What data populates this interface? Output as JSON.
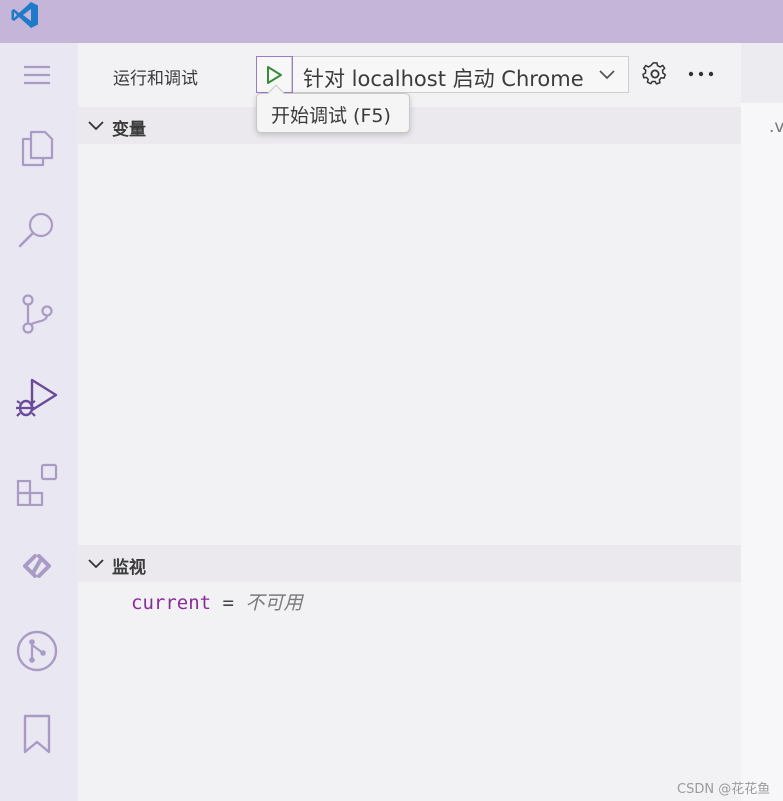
{
  "titlebar": {
    "logo_icon": "vscode-logo-icon",
    "background": "#c5b5d9"
  },
  "activitybar": {
    "items": [
      {
        "name": "menu",
        "icon": "hamburger-menu-icon"
      },
      {
        "name": "explorer",
        "icon": "files-icon"
      },
      {
        "name": "search",
        "icon": "search-icon"
      },
      {
        "name": "source-control",
        "icon": "source-control-icon"
      },
      {
        "name": "run-and-debug",
        "icon": "run-debug-icon",
        "active": true
      },
      {
        "name": "extensions",
        "icon": "extensions-icon"
      },
      {
        "name": "remote",
        "icon": "remote-icon"
      },
      {
        "name": "git-graph",
        "icon": "git-graph-icon"
      },
      {
        "name": "bookmarks",
        "icon": "bookmark-icon"
      }
    ]
  },
  "sidebar": {
    "title": "运行和调试",
    "config": {
      "start_icon": "play-icon",
      "label": "针对 localhost 启动 Chrome",
      "dropdown_icon": "chevron-down-icon"
    },
    "gear_icon": "gear-icon",
    "more_icon": "ellipsis-icon",
    "tooltip": "开始调试 (F5)",
    "sections": {
      "variables": {
        "title": "变量",
        "chevron_icon": "chevron-down-icon"
      },
      "watch": {
        "title": "监视",
        "chevron_icon": "chevron-down-icon",
        "expression": {
          "name": "current",
          "equals": "=",
          "value": "不可用"
        }
      }
    }
  },
  "editor": {
    "tab_text": ".v"
  },
  "watermark": "CSDN @花花鱼",
  "colors": {
    "accent": "#7a5ca8",
    "play": "#3a8a3a",
    "watch_name": "#8a2b9a"
  }
}
